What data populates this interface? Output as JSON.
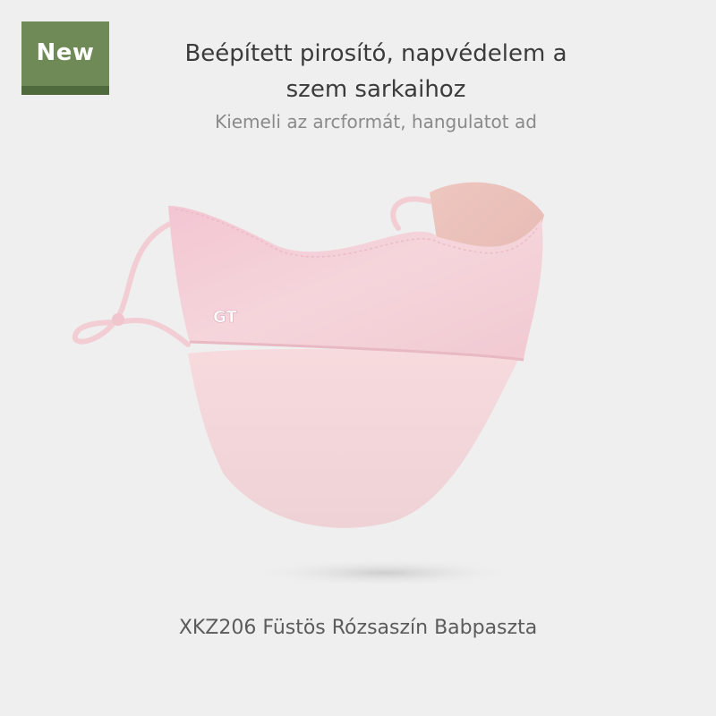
{
  "badge": {
    "label": "New",
    "color": "#6f8a57"
  },
  "headline": {
    "line1": "Beépített pirosító, napvédelem a",
    "line2": "szem sarkaihoz"
  },
  "subheadline": "Kiemeli az arcformát, hangulatot ad",
  "product": {
    "image": "pink-face-mask",
    "logo_text": "GT",
    "caption": "XKZ206 Füstös Rózsaszín Babpaszta",
    "colors": {
      "mask": "#f2ccd3",
      "lining": "#eac4bd",
      "background": "#efefef"
    }
  }
}
